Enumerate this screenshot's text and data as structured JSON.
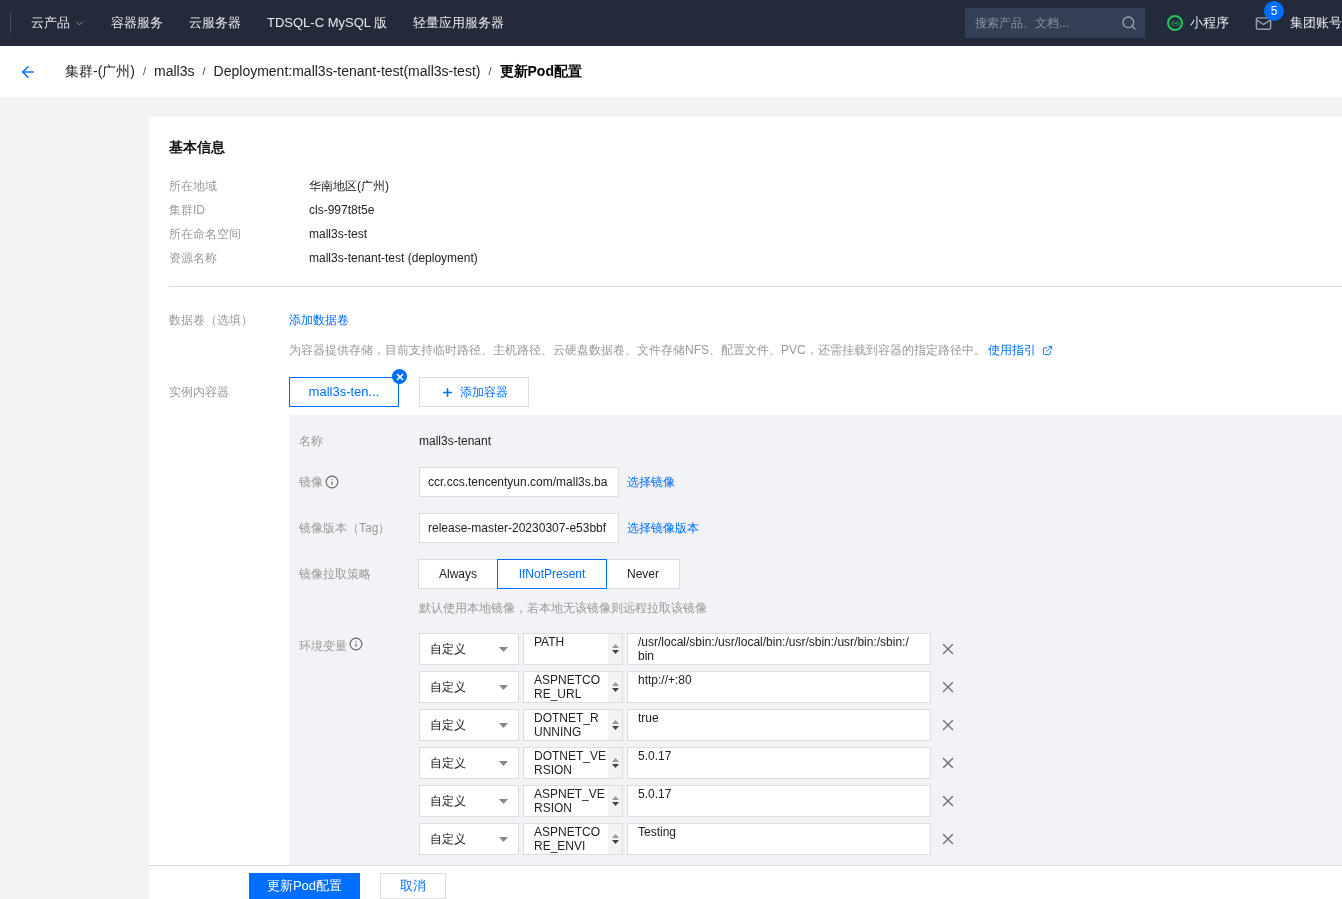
{
  "topnav": {
    "menu": [
      {
        "label": "云产品",
        "dropdown": true
      },
      {
        "label": "容器服务",
        "dropdown": false
      },
      {
        "label": "云服务器",
        "dropdown": false
      },
      {
        "label": "TDSQL-C MySQL 版",
        "dropdown": false
      },
      {
        "label": "轻量应用服务器",
        "dropdown": false
      }
    ],
    "search": {
      "placeholder": "搜索产品、文档..."
    },
    "mini_program": "小程序",
    "mail_badge": "5",
    "account": "集团账号"
  },
  "breadcrumb": [
    "集群-(广州)",
    "mall3s",
    "Deployment:mall3s-tenant-test(mall3s-test)",
    "更新Pod配置"
  ],
  "breadcrumb_separators": [
    "/",
    "/",
    "/"
  ],
  "basic_info": {
    "title": "基本信息",
    "rows": [
      {
        "label": "所在地域",
        "value": "华南地区(广州)"
      },
      {
        "label": "集群ID",
        "value": "cls-997t8t5e"
      },
      {
        "label": "所在命名空间",
        "value": "mall3s-test"
      },
      {
        "label": "资源名称",
        "value": "mall3s-tenant-test (deployment)"
      }
    ]
  },
  "volumes": {
    "label": "数据卷（选填）",
    "link": "添加数据卷",
    "hint": "为容器提供存储，目前支持临时路径、主机路径、云硬盘数据卷、文件存储NFS、配置文件、PVC，还需挂载到容器的指定路径中。",
    "guide_link": "使用指引"
  },
  "containers": {
    "label": "实例内容器",
    "tabs": [
      {
        "label": "mall3s-ten...",
        "selected": true
      }
    ],
    "add_button": "添加容器"
  },
  "container": {
    "name_label": "名称",
    "name": "mall3s-tenant",
    "image_label": "镜像",
    "image": "ccr.ccs.tencentyun.com/mall3s.ba",
    "image_link": "选择镜像",
    "tag_label": "镜像版本（Tag）",
    "tag": "release-master-20230307-e53bbf",
    "tag_link": "选择镜像版本",
    "pull_label": "镜像拉取策略",
    "pull_options": [
      {
        "label": "Always",
        "selected": false
      },
      {
        "label": "IfNotPresent",
        "selected": true
      },
      {
        "label": "Never",
        "selected": false
      }
    ],
    "pull_hint": "默认使用本地镜像，若本地无该镜像则远程拉取该镜像",
    "env_label": "环境变量",
    "env": [
      {
        "type": "自定义",
        "key": "PATH",
        "value": "/usr/local/sbin:/usr/local/bin:/usr/sbin:/usr/bin:/sbin:/bin"
      },
      {
        "type": "自定义",
        "key": "ASPNETCORE_URL",
        "value": "http://+:80"
      },
      {
        "type": "自定义",
        "key": "DOTNET_RUNNING",
        "value": "true"
      },
      {
        "type": "自定义",
        "key": "DOTNET_VERSION",
        "value": "5.0.17"
      },
      {
        "type": "自定义",
        "key": "ASPNET_VERSION",
        "value": "5.0.17"
      },
      {
        "type": "自定义",
        "key": "ASPNETCORE_ENVI",
        "value": "Testing"
      }
    ]
  },
  "footer": {
    "submit": "更新Pod配置",
    "cancel": "取消"
  }
}
